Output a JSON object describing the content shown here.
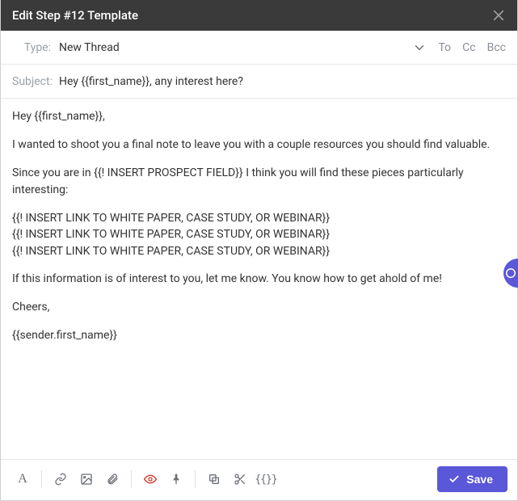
{
  "title": "Edit Step #12 Template",
  "type": {
    "label": "Type:",
    "value": "New Thread",
    "recipients": {
      "to": "To",
      "cc": "Cc",
      "bcc": "Bcc"
    }
  },
  "subject": {
    "label": "Subject:",
    "value": "Hey {{first_name}}, any interest here?"
  },
  "body": {
    "greeting": "Hey {{first_name}},",
    "para1": "I wanted to shoot you a final note to leave you with a couple resources you should find valuable.",
    "para2": "Since you are in {{! INSERT PROSPECT FIELD}} I think you will find these pieces particularly interesting:",
    "links": [
      "{{! INSERT LINK TO WHITE PAPER, CASE STUDY, OR WEBINAR}}",
      "{{! INSERT LINK TO WHITE PAPER, CASE STUDY, OR WEBINAR}}",
      "{{! INSERT LINK TO WHITE PAPER, CASE STUDY, OR WEBINAR}}"
    ],
    "para3": "If this information is of interest to you, let me know. You know how to get ahold of me!",
    "signoff": "Cheers,",
    "signature": "{{sender.first_name}}"
  },
  "toolbar": {
    "font_style": "A",
    "variables": "{{}}"
  },
  "actions": {
    "save": "Save"
  },
  "colors": {
    "accent": "#5B57D9",
    "danger": "#d9362b",
    "header": "#3a3a3a"
  }
}
